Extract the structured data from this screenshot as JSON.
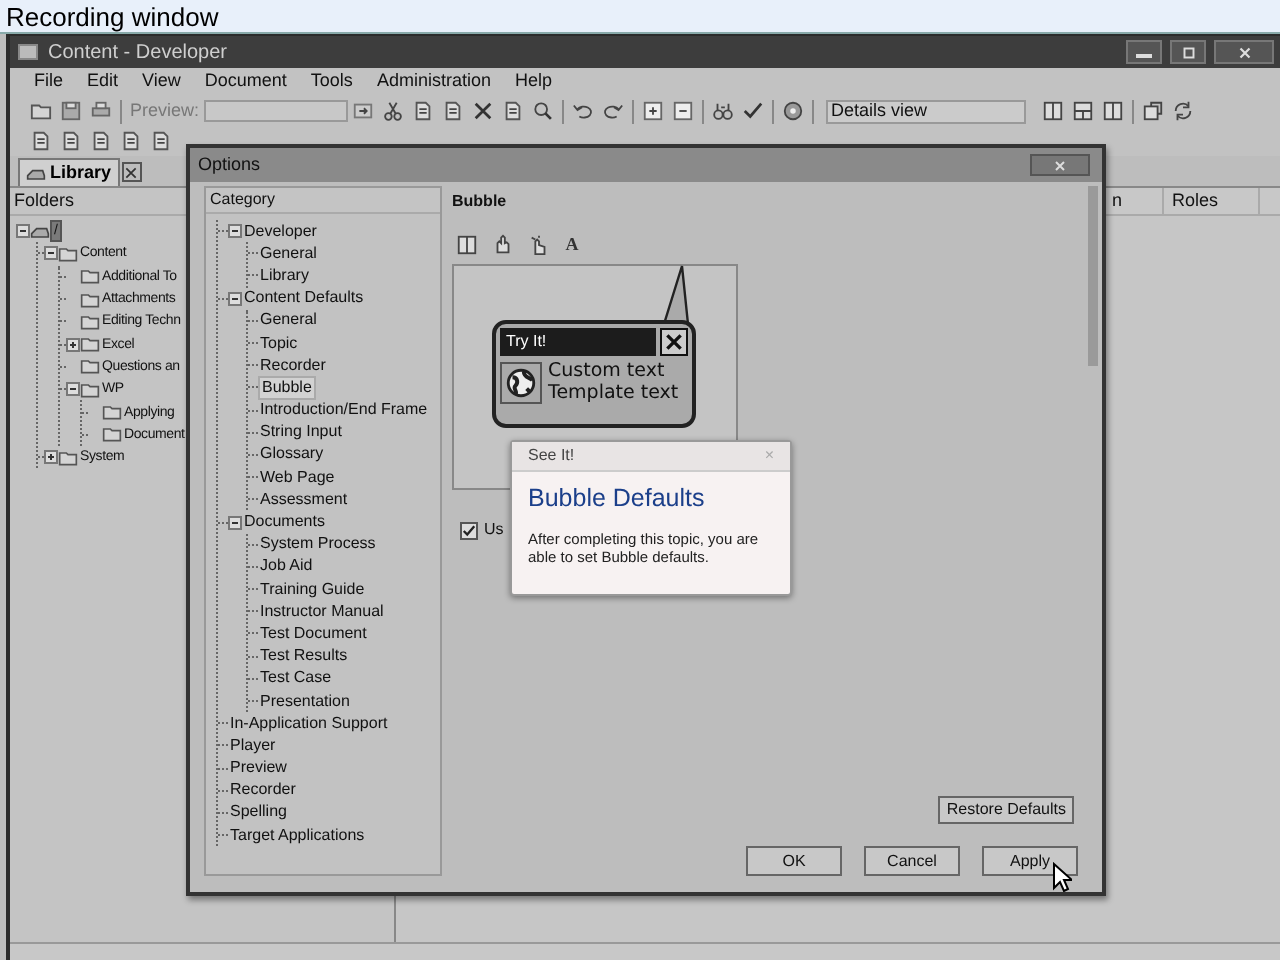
{
  "recording_bar": {
    "title": "Recording window"
  },
  "window": {
    "title": "Content - Developer"
  },
  "menu": [
    "File",
    "Edit",
    "View",
    "Document",
    "Tools",
    "Administration",
    "Help"
  ],
  "toolbar": {
    "preview_label": "Preview:",
    "view_select": "Details view"
  },
  "library_tab": {
    "label": "Library",
    "selected": true
  },
  "folders": {
    "header": "Folders",
    "tree": [
      {
        "label": "/",
        "kind": "drive",
        "selected": true,
        "expanded": true,
        "children": [
          {
            "label": "Content",
            "kind": "folder",
            "selected": false,
            "expanded": true,
            "children": [
              {
                "label": "Additional To",
                "kind": "folder",
                "selected": false
              },
              {
                "label": "Attachments",
                "kind": "folder",
                "selected": false
              },
              {
                "label": "Editing Techn",
                "kind": "folder",
                "selected": false
              },
              {
                "label": "Excel",
                "kind": "folder",
                "selected": false,
                "expanded": false
              },
              {
                "label": "Questions an",
                "kind": "folder",
                "selected": false
              },
              {
                "label": "WP",
                "kind": "folder",
                "selected": false,
                "expanded": true,
                "children": [
                  {
                    "label": "Applying",
                    "kind": "folder",
                    "selected": false
                  },
                  {
                    "label": "Document",
                    "kind": "folder",
                    "selected": false
                  }
                ]
              }
            ]
          },
          {
            "label": "System",
            "kind": "folder",
            "selected": false,
            "expanded": false
          }
        ]
      }
    ]
  },
  "list": {
    "columns": [
      "n",
      "Roles"
    ]
  },
  "options_dialog": {
    "title": "Options",
    "category_header": "Category",
    "categories": [
      {
        "label": "Developer",
        "selected": false,
        "expanded": true,
        "children": [
          {
            "label": "General",
            "selected": false
          },
          {
            "label": "Library",
            "selected": false
          }
        ]
      },
      {
        "label": "Content Defaults",
        "selected": false,
        "expanded": true,
        "children": [
          {
            "label": "General",
            "selected": false
          },
          {
            "label": "Topic",
            "selected": false
          },
          {
            "label": "Recorder",
            "selected": false
          },
          {
            "label": "Bubble",
            "selected": true
          },
          {
            "label": "Introduction/End Frame",
            "selected": false
          },
          {
            "label": "String Input",
            "selected": false
          },
          {
            "label": "Glossary",
            "selected": false
          },
          {
            "label": "Web Page",
            "selected": false
          },
          {
            "label": "Assessment",
            "selected": false
          }
        ]
      },
      {
        "label": "Documents",
        "selected": false,
        "expanded": true,
        "children": [
          {
            "label": "System Process",
            "selected": false
          },
          {
            "label": "Job Aid",
            "selected": false
          },
          {
            "label": "Training Guide",
            "selected": false
          },
          {
            "label": "Instructor Manual",
            "selected": false
          },
          {
            "label": "Test Document",
            "selected": false
          },
          {
            "label": "Test Results",
            "selected": false
          },
          {
            "label": "Test Case",
            "selected": false
          },
          {
            "label": "Presentation",
            "selected": false
          }
        ]
      },
      {
        "label": "In-Application Support",
        "selected": false
      },
      {
        "label": "Player",
        "selected": false
      },
      {
        "label": "Preview",
        "selected": false
      },
      {
        "label": "Recorder",
        "selected": false
      },
      {
        "label": "Spelling",
        "selected": false
      },
      {
        "label": "Target Applications",
        "selected": false
      }
    ],
    "page_title": "Bubble",
    "font_button": "A",
    "preview": {
      "header": "Try It!",
      "lines": [
        "Custom text",
        "Template text"
      ]
    },
    "use_checkbox": {
      "label": "Us",
      "checked": true
    },
    "restore_button": "Restore Defaults",
    "buttons": [
      "OK",
      "Cancel",
      "Apply"
    ]
  },
  "tooltip": {
    "title": "See It!",
    "close": "×",
    "heading": "Bubble Defaults",
    "body": "After completing this topic, you are able to set Bubble defaults."
  }
}
